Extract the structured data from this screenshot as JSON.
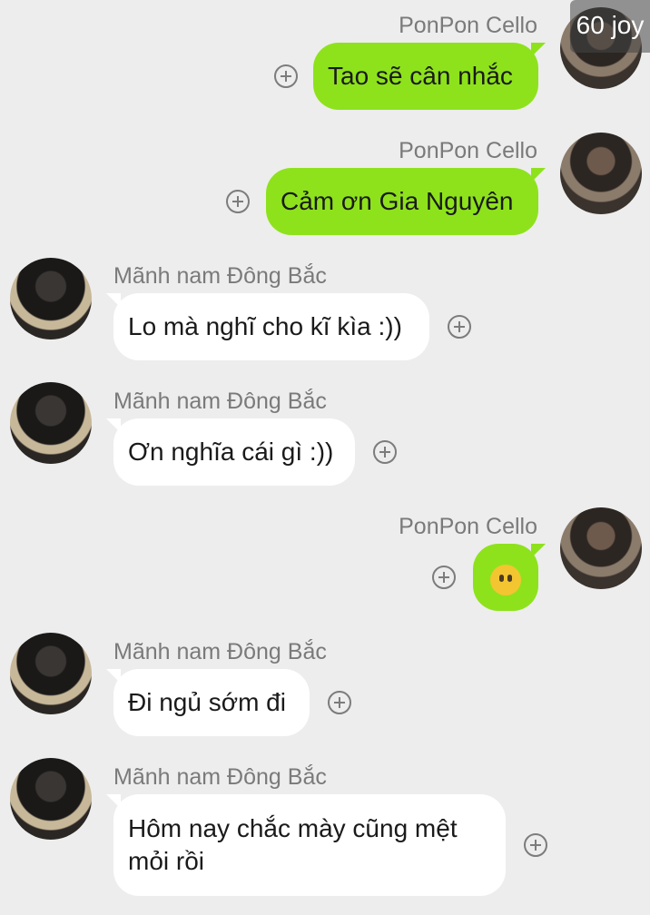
{
  "badge": "60 joy",
  "messages": [
    {
      "side": "right",
      "sender": "PonPon Cello",
      "text": "Tao sẽ cân nhắc"
    },
    {
      "side": "right",
      "sender": "PonPon Cello",
      "text": "Cảm ơn Gia Nguyên"
    },
    {
      "side": "left",
      "sender": "Mãnh nam Đông Bắc",
      "text": "Lo mà nghĩ cho kĩ kìa :))"
    },
    {
      "side": "left",
      "sender": "Mãnh nam Đông Bắc",
      "text": "Ơn nghĩa cái gì :))"
    },
    {
      "side": "right",
      "sender": "PonPon Cello",
      "text": "",
      "emoji": "neutral-face-emoji"
    },
    {
      "side": "left",
      "sender": "Mãnh nam Đông Bắc",
      "text": "Đi ngủ sớm đi"
    },
    {
      "side": "left",
      "sender": "Mãnh nam Đông Bắc",
      "text_line1": "Hôm nay chắc mày cũng mệt",
      "text_line2": "mỏi rồi"
    }
  ],
  "colors": {
    "background": "#ededed",
    "outgoing_bubble": "#8ee21c",
    "incoming_bubble": "#ffffff"
  }
}
